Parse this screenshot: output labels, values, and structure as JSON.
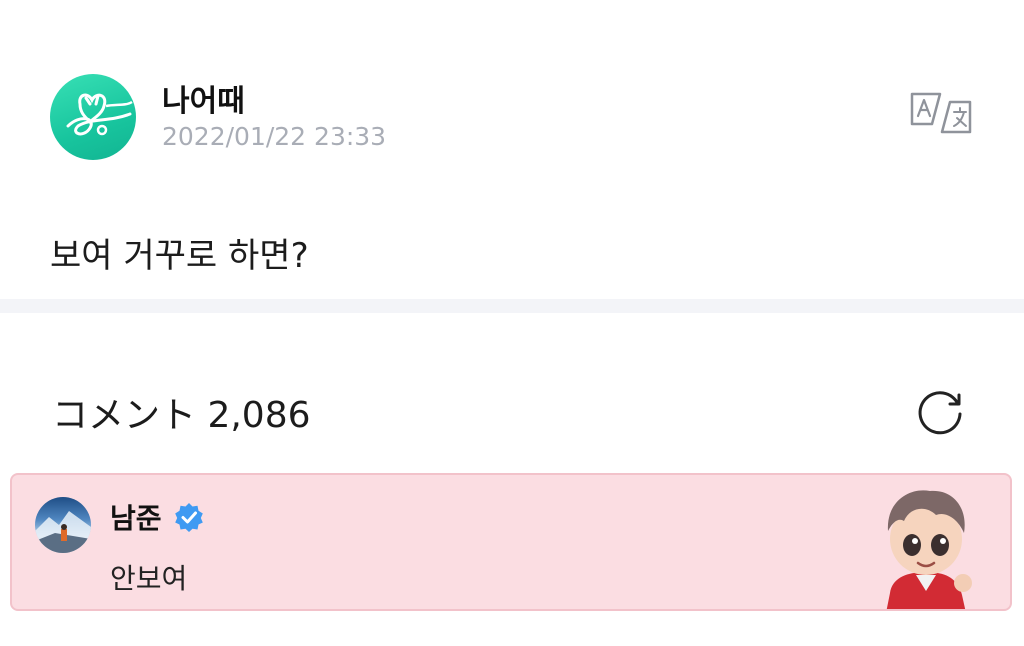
{
  "post": {
    "author": "나어때",
    "timestamp": "2022/01/22 23:33",
    "body": "보여 거꾸로 하면?",
    "translate_icon": "translate-icon",
    "avatar_icon": "weverse-logo-avatar"
  },
  "comments_section": {
    "label": "コメント 2,086",
    "refresh_icon": "refresh-icon"
  },
  "pinned_comment": {
    "author": "남준",
    "verified_icon": "verified-badge-icon",
    "text": "안보여",
    "background_color": "#fbdde2",
    "sticker": "character-sticker"
  },
  "colors": {
    "avatar_green": "#1ecba3",
    "timestamp_gray": "#a9adb6",
    "verified_blue": "#3f9af2",
    "divider": "#f3f4f8"
  }
}
